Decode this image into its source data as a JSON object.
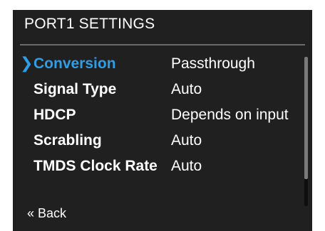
{
  "screen": {
    "title": "PORT1 SETTINGS",
    "accent_color": "#2f9ee6",
    "background_color": "#202020"
  },
  "menu": {
    "selected_index": 0,
    "cursor_glyph": "❯",
    "items": [
      {
        "label": "Conversion",
        "value": "Passthrough"
      },
      {
        "label": "Signal Type",
        "value": "Auto"
      },
      {
        "label": "HDCP",
        "value": "Depends on input"
      },
      {
        "label": "Scrabling",
        "value": "Auto"
      },
      {
        "label": "TMDS Clock Rate",
        "value": "Auto"
      }
    ]
  },
  "scrollbar": {
    "visible_fraction": 0.82,
    "position_fraction": 0.0
  },
  "footer": {
    "back_label": "« Back"
  }
}
